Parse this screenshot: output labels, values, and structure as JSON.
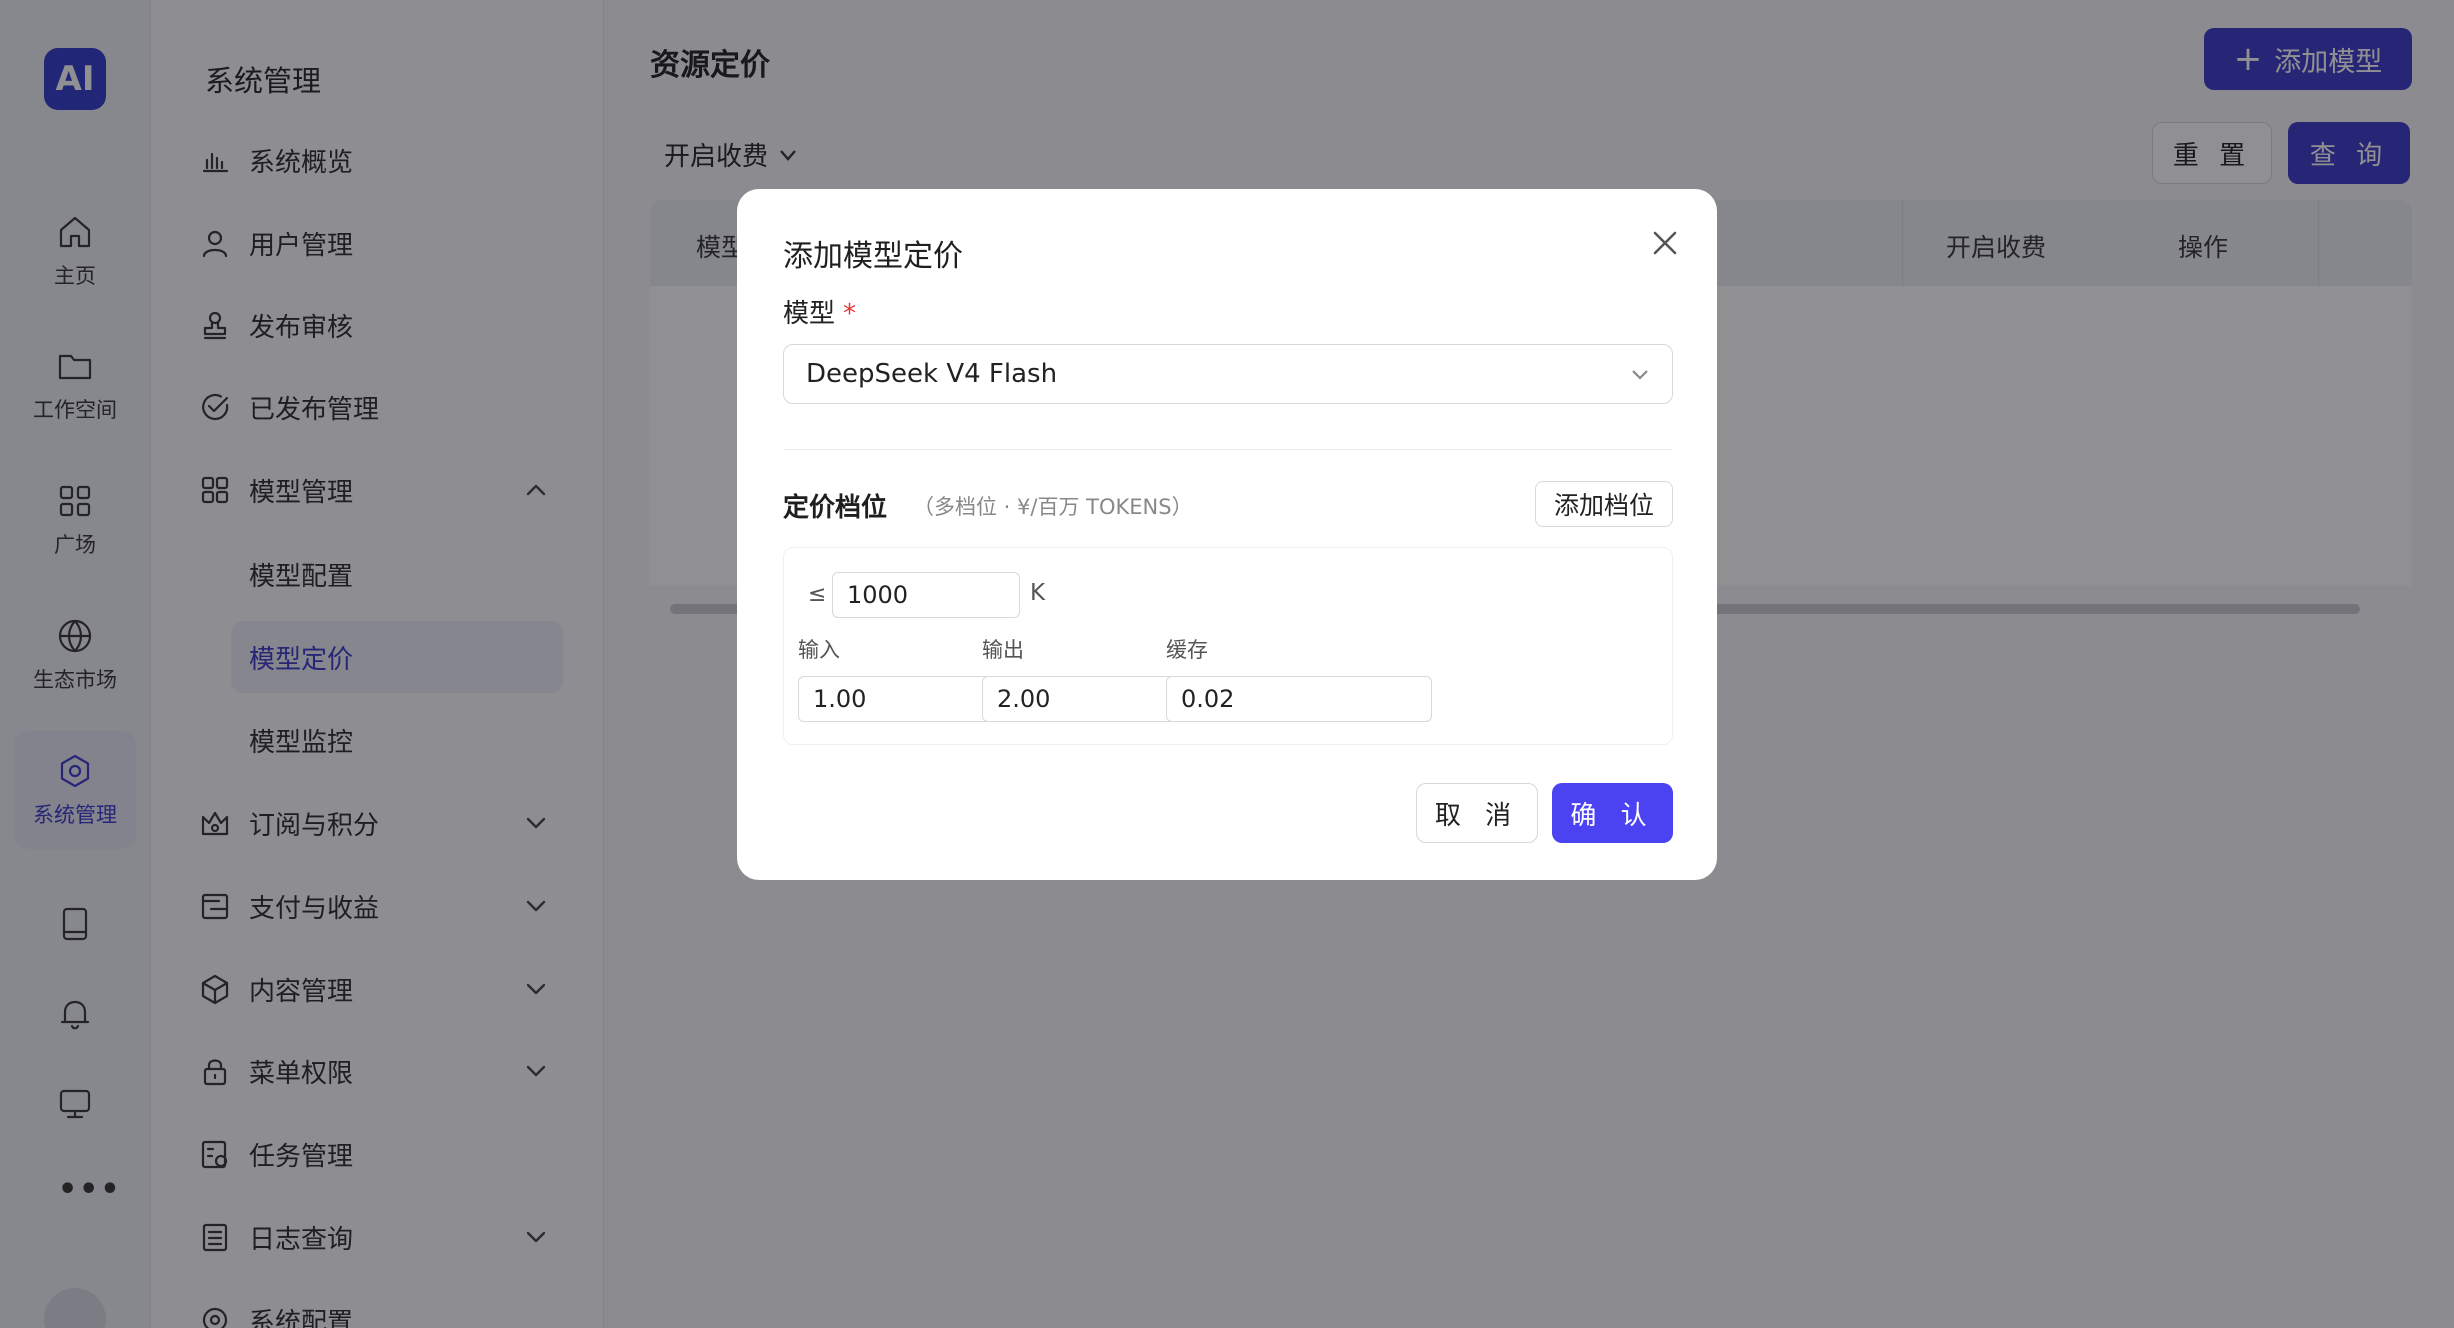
{
  "app": {
    "logo_text": "AI"
  },
  "rail": {
    "items": [
      {
        "label": "主页",
        "icon": "home-icon"
      },
      {
        "label": "工作空间",
        "icon": "folder-icon"
      },
      {
        "label": "广场",
        "icon": "grid-icon"
      },
      {
        "label": "生态市场",
        "icon": "globe-icon"
      },
      {
        "label": "系统管理",
        "icon": "gear-icon",
        "active": true
      }
    ],
    "bottom_icons": [
      "book-icon",
      "bell-icon",
      "monitor-icon",
      "more-icon"
    ],
    "more_label": "•••"
  },
  "sidebar": {
    "title": "系统管理",
    "items": [
      {
        "label": "系统概览",
        "icon": "bar-chart-icon"
      },
      {
        "label": "用户管理",
        "icon": "user-icon"
      },
      {
        "label": "发布审核",
        "icon": "stamp-icon"
      },
      {
        "label": "已发布管理",
        "icon": "check-circle-icon"
      },
      {
        "label": "模型管理",
        "icon": "apps-icon",
        "expanded": true
      },
      {
        "label": "订阅与积分",
        "icon": "crown-icon"
      },
      {
        "label": "支付与收益",
        "icon": "wallet-icon"
      },
      {
        "label": "内容管理",
        "icon": "cube-icon"
      },
      {
        "label": "菜单权限",
        "icon": "lock-icon"
      },
      {
        "label": "任务管理",
        "icon": "task-icon"
      },
      {
        "label": "日志查询",
        "icon": "log-icon"
      },
      {
        "label": "系统配置",
        "icon": "settings-icon"
      }
    ],
    "submenu": [
      {
        "label": "模型配置"
      },
      {
        "label": "模型定价",
        "active": true
      },
      {
        "label": "模型监控"
      }
    ]
  },
  "main": {
    "page_title": "资源定价",
    "add_button": "添加模型",
    "filter_label": "开启收费",
    "reset_button": "重 置",
    "query_button": "查 询",
    "table_headers": {
      "model": "模型",
      "charge": "开启收费",
      "action": "操作"
    }
  },
  "modal": {
    "title": "添加模型定价",
    "model_label": "模型",
    "required_mark": "*",
    "model_value": "DeepSeek V4 Flash",
    "tier_title": "定价档位",
    "tier_hint": "（多档位 · ¥/百万 TOKENS）",
    "add_tier_button": "添加档位",
    "tier": {
      "le_symbol": "≤",
      "limit_value": "1000",
      "unit": "K",
      "input_label": "输入",
      "input_value": "1.00",
      "output_label": "输出",
      "output_value": "2.00",
      "cache_label": "缓存",
      "cache_value": "0.02"
    },
    "cancel_button": "取 消",
    "confirm_button": "确 认"
  },
  "colors": {
    "accent": "#3a37c9",
    "confirm": "#4b43f2",
    "required": "#e53935"
  }
}
